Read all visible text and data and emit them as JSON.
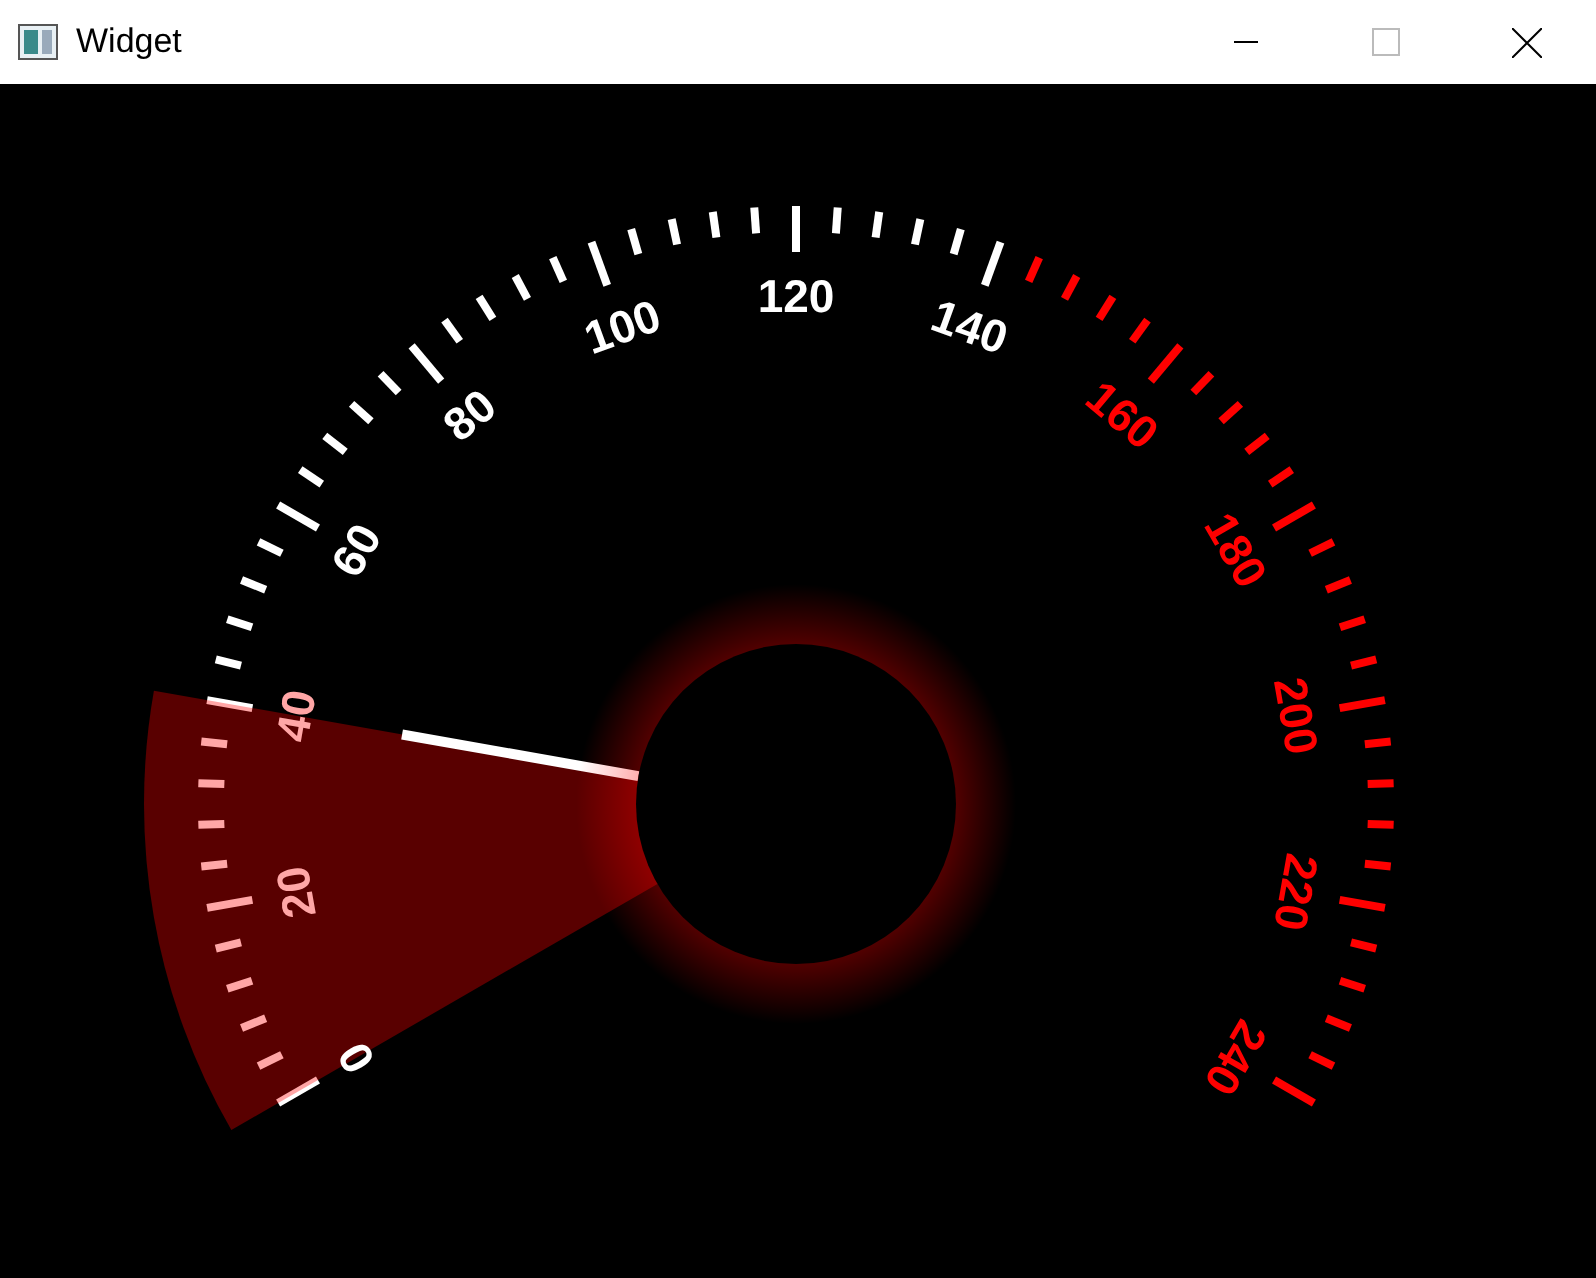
{
  "window": {
    "title": "Widget"
  },
  "gauge": {
    "level": 0.1667,
    "labels": [
      {
        "text": "0",
        "color": "#ffffff"
      },
      {
        "text": "20",
        "color": "#ffa6a6"
      },
      {
        "text": "40",
        "color": "#ffa6a6"
      },
      {
        "text": "60",
        "color": "#ffffff"
      },
      {
        "text": "80",
        "color": "#ffffff"
      },
      {
        "text": "100",
        "color": "#ffffff"
      },
      {
        "text": "120",
        "color": "#ffffff"
      },
      {
        "text": "140",
        "color": "#ffffff"
      },
      {
        "text": "160",
        "color": "#ff0000"
      },
      {
        "text": "180",
        "color": "#ff0000"
      },
      {
        "text": "200",
        "color": "#ff0000"
      },
      {
        "text": "220",
        "color": "#ff0000"
      },
      {
        "text": "240",
        "color": "#ff0000"
      }
    ]
  }
}
